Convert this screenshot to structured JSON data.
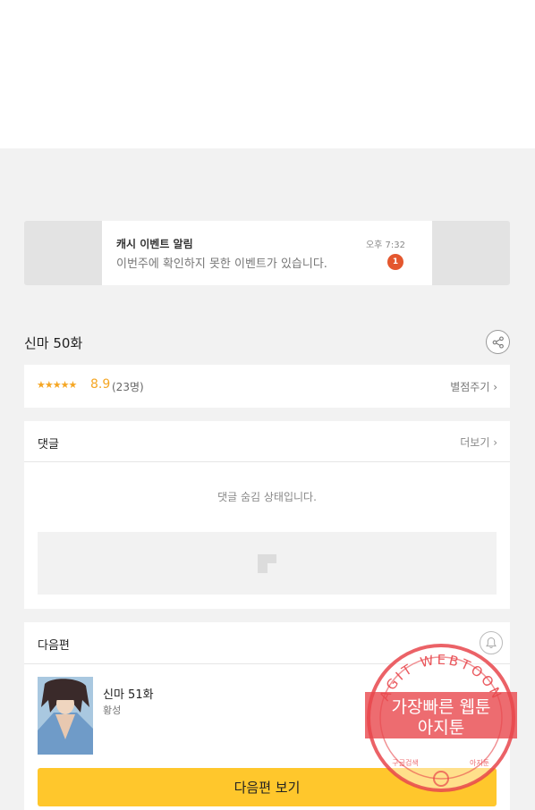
{
  "notification": {
    "title": "캐시 이벤트 알림",
    "body": "이번주에 확인하지 못한 이벤트가 있습니다.",
    "time": "오후 7:32",
    "badge": "1"
  },
  "episode": {
    "title": "신마 50화",
    "share_icon": "share-icon"
  },
  "rating": {
    "stars": "★★★★★",
    "score": "8.9",
    "count": "(23명)",
    "rate_link": "별점주기 ›",
    "star_color": "#f5a623"
  },
  "comments": {
    "title": "댓글",
    "more": "더보기 ›",
    "hidden_message": "댓글 숨김 상태입니다."
  },
  "next": {
    "section_title": "다음편",
    "bell_icon": "bell-icon",
    "episode_title": "신마 51화",
    "author": "황성",
    "button_label": "다음편 보기",
    "button_color": "#ffc72c"
  },
  "watermark": {
    "arc_text": "AGIT WEBTOON",
    "line1": "가장빠른 웹툰",
    "line2": "아지툰",
    "small_left": "구글검색",
    "small_right": "아지툰",
    "color": "#e8474c"
  }
}
